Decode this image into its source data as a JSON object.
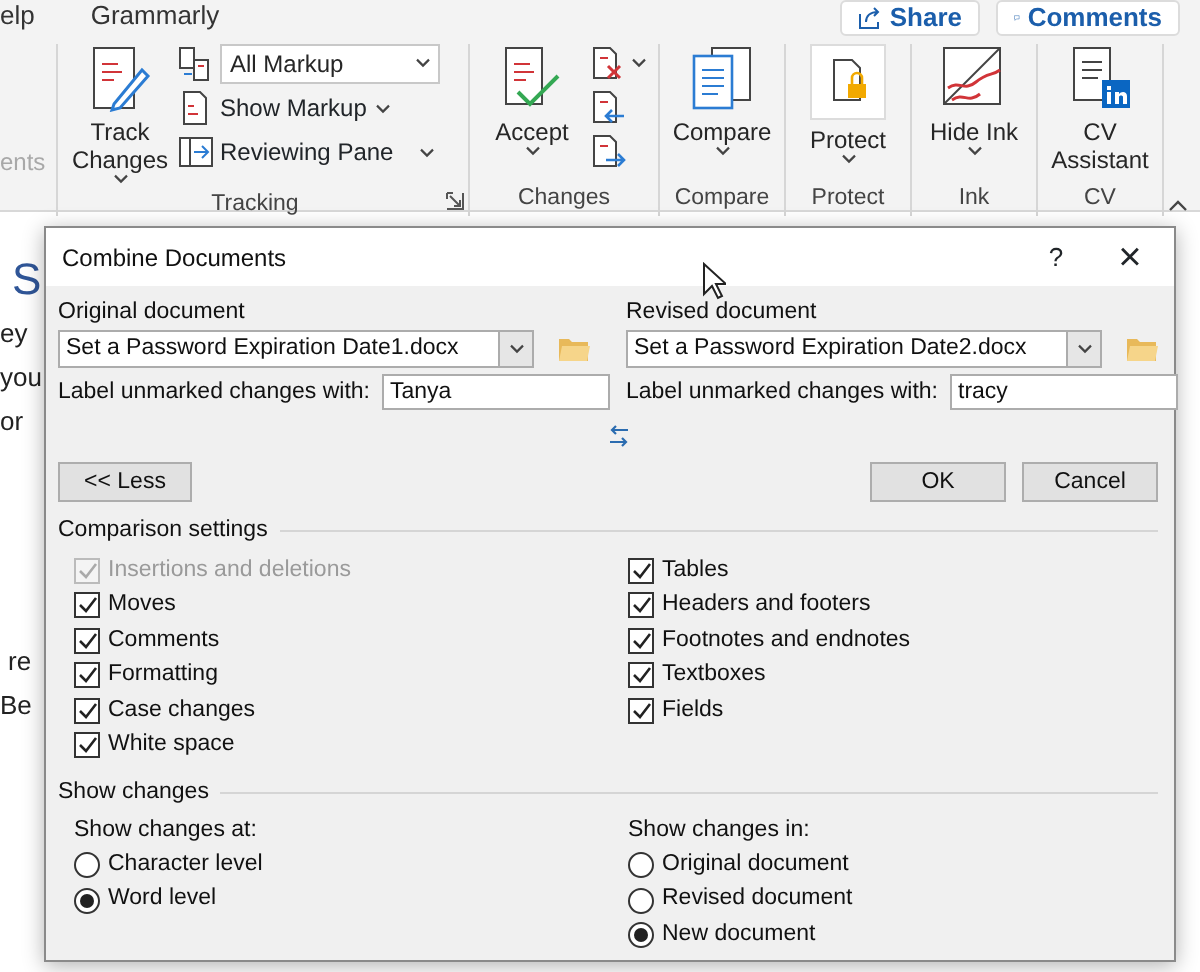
{
  "ribbon": {
    "tabs": [
      {
        "label": "elp"
      },
      {
        "label": "Grammarly"
      }
    ],
    "share": "Share",
    "comments": "Comments",
    "cut_label": "ents",
    "groups": [
      {
        "label": "Tracking",
        "launcher": true,
        "large": [
          {
            "label": "Track Changes",
            "menu": true
          }
        ],
        "small": [
          {
            "kind": "dropdown",
            "label": "All Markup"
          },
          {
            "kind": "button",
            "label": "Show Markup",
            "menu": true
          },
          {
            "kind": "button",
            "label": "Reviewing Pane",
            "menu": true
          }
        ]
      },
      {
        "label": "Changes",
        "large": [
          {
            "label": "Accept",
            "menu": true
          }
        ],
        "small": [
          {
            "kind": "icon",
            "menu": true
          },
          {
            "kind": "icon",
            "menu": false
          },
          {
            "kind": "icon",
            "menu": false
          }
        ]
      },
      {
        "label": "Compare",
        "large": [
          {
            "label": "Compare",
            "menu": true
          }
        ]
      },
      {
        "label": "Protect",
        "large": [
          {
            "label": "Protect",
            "menu": true
          }
        ]
      },
      {
        "label": "Ink",
        "large": [
          {
            "label": "Hide Ink",
            "menu": true
          }
        ]
      },
      {
        "label": "CV",
        "large": [
          {
            "label": "CV Assistant",
            "menu": false
          }
        ]
      }
    ]
  },
  "document": {
    "lines": [
      {
        "kind": "heading",
        "text": "S"
      },
      {
        "kind": "text",
        "text": "ey"
      },
      {
        "kind": "text",
        "text": "you"
      },
      {
        "kind": "text",
        "text": "or"
      },
      {
        "kind": "gap",
        "text": "re"
      },
      {
        "kind": "text",
        "text": "Be"
      }
    ]
  },
  "dialog": {
    "title": "Combine Documents",
    "help": "?",
    "close": "×",
    "original": {
      "heading": "Original document",
      "file": "Set a Password Expiration Date1.docx",
      "label": "Label unmarked changes with:",
      "value": "Tanya"
    },
    "revised": {
      "heading": "Revised document",
      "file": "Set a Password Expiration Date2.docx",
      "label": "Label unmarked changes with:",
      "value": "tracy"
    },
    "less": "<< Less",
    "ok": "OK",
    "cancel": "Cancel",
    "comparison": {
      "title": "Comparison settings",
      "left": [
        {
          "label": "Insertions and deletions",
          "checked": true,
          "disabled": true
        },
        {
          "label": "Moves",
          "checked": true,
          "disabled": false
        },
        {
          "label": "Comments",
          "checked": true,
          "disabled": false
        },
        {
          "label": "Formatting",
          "checked": true,
          "disabled": false
        },
        {
          "label": "Case changes",
          "checked": true,
          "disabled": false
        },
        {
          "label": "White space",
          "checked": true,
          "disabled": false
        }
      ],
      "right": [
        {
          "label": "Tables",
          "checked": true,
          "disabled": false
        },
        {
          "label": "Headers and footers",
          "checked": true,
          "disabled": false
        },
        {
          "label": "Footnotes and endnotes",
          "checked": true,
          "disabled": false
        },
        {
          "label": "Textboxes",
          "checked": true,
          "disabled": false
        },
        {
          "label": "Fields",
          "checked": true,
          "disabled": false
        }
      ]
    },
    "show_changes": {
      "title": "Show changes",
      "at": {
        "label": "Show changes at:",
        "options": [
          {
            "label": "Character level",
            "selected": false
          },
          {
            "label": "Word level",
            "selected": true
          }
        ]
      },
      "in": {
        "label": "Show changes in:",
        "options": [
          {
            "label": "Original document",
            "selected": false
          },
          {
            "label": "Revised document",
            "selected": false
          },
          {
            "label": "New document",
            "selected": true
          }
        ]
      }
    }
  }
}
